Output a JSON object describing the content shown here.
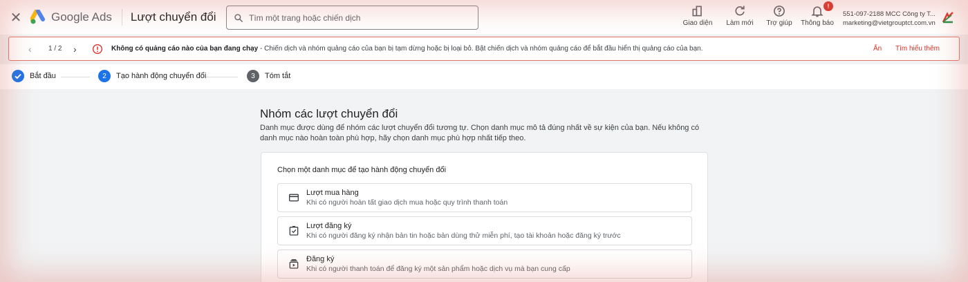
{
  "header": {
    "close_icon": "close-icon",
    "brand": "Google Ads",
    "page_title": "Lượt chuyển đổi",
    "search_placeholder": "Tìm một trang hoặc chiến dịch",
    "tools": [
      {
        "label": "Giao diện",
        "icon": "appearance-icon"
      },
      {
        "label": "Làm mới",
        "icon": "refresh-icon"
      },
      {
        "label": "Trợ giúp",
        "icon": "help-icon"
      },
      {
        "label": "Thông báo",
        "icon": "bell-icon",
        "badge": "!"
      }
    ],
    "account_id": "551-097-2188 MCC Công ty T...",
    "account_email": "marketing@vietgrouptct.com.vn"
  },
  "alert": {
    "pager": "1 / 2",
    "bold_text": "Không có quảng cáo nào của bạn đang chạy",
    "text": " - Chiến dịch và nhóm quảng cáo của bạn bị tạm dừng hoặc bị loại bỏ. Bật chiến dịch và nhóm quảng cáo để bắt đầu hiển thị quảng cáo của bạn.",
    "hide_label": "Ẩn",
    "learn_more_label": "Tìm hiểu thêm"
  },
  "stepper": {
    "steps": [
      {
        "label": "Bắt đầu",
        "state": "done"
      },
      {
        "number": "2",
        "label": "Tạo hành động chuyển đổi",
        "state": "active"
      },
      {
        "number": "3",
        "label": "Tóm tắt",
        "state": "pending"
      }
    ]
  },
  "main": {
    "title": "Nhóm các lượt chuyển đổi",
    "description": "Danh mục được dùng để nhóm các lượt chuyển đổi tương tự. Chọn danh mục mô tả đúng nhất về sự kiện của bạn. Nếu không có danh mục nào hoàn toàn phù hợp, hãy chọn danh mục phù hợp nhất tiếp theo.",
    "card_title": "Chọn một danh mục để tạo hành động chuyển đổi",
    "options": [
      {
        "title": "Lượt mua hàng",
        "desc": "Khi có người hoàn tất giao dịch mua hoặc quy trình thanh toán",
        "icon": "credit-card-icon"
      },
      {
        "title": "Lượt đăng ký",
        "desc": "Khi có người đăng ký nhận bản tin hoặc bản dùng thử miễn phí, tạo tài khoản hoặc đăng ký trước",
        "icon": "checkbox-icon"
      },
      {
        "title": "Đăng ký",
        "desc": "Khi có người thanh toán để đăng ký một sản phẩm hoặc dịch vụ mà bạn cung cấp",
        "icon": "subscription-icon"
      }
    ]
  },
  "colors": {
    "accent": "#1a73e8",
    "alert_red": "#d93025",
    "step_pending": "#5f6368"
  }
}
